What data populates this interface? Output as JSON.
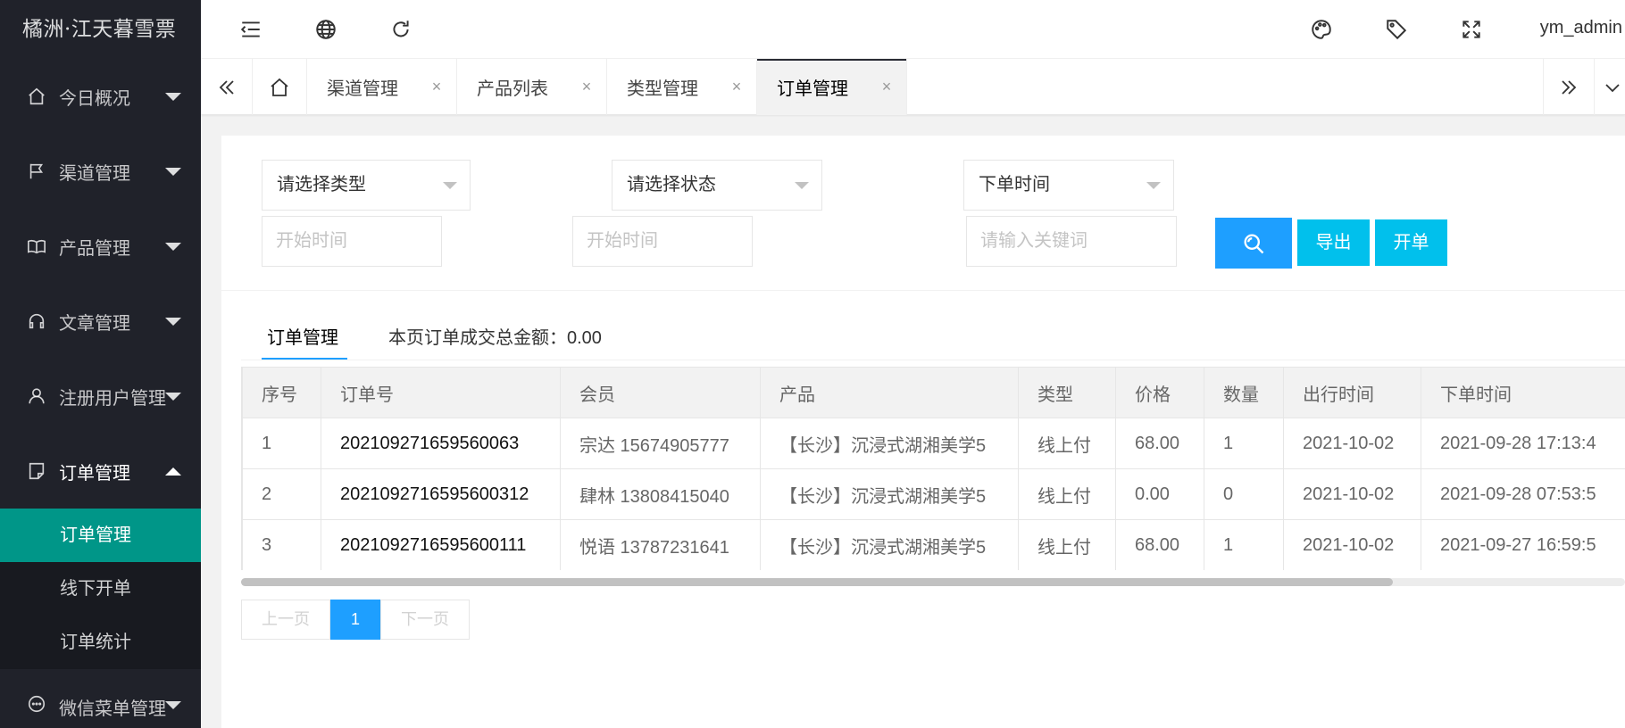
{
  "app": {
    "logo": "橘洲·江天暮雪票"
  },
  "sidebar": {
    "items": [
      {
        "label": "今日概况",
        "icon": "home-icon"
      },
      {
        "label": "渠道管理",
        "icon": "flag-icon"
      },
      {
        "label": "产品管理",
        "icon": "book-icon"
      },
      {
        "label": "文章管理",
        "icon": "headset-icon"
      },
      {
        "label": "注册用户管理",
        "icon": "user-icon"
      },
      {
        "label": "订单管理",
        "icon": "note-icon",
        "open": true
      },
      {
        "label": "微信菜单管理",
        "icon": "chat-icon"
      }
    ],
    "submenu": [
      {
        "label": "订单管理",
        "active": true
      },
      {
        "label": "线下开单"
      },
      {
        "label": "订单统计"
      }
    ]
  },
  "header": {
    "icons": [
      "menu-fold-icon",
      "globe-icon",
      "refresh-icon",
      "palette-icon",
      "tag-icon",
      "fullscreen-icon"
    ],
    "user": "ym_admin"
  },
  "tabs": {
    "items": [
      {
        "label": "渠道管理"
      },
      {
        "label": "产品列表"
      },
      {
        "label": "类型管理"
      },
      {
        "label": "订单管理",
        "active": true
      }
    ],
    "close_glyph": "×"
  },
  "filters": {
    "type_select": "请选择类型",
    "status_select": "请选择状态",
    "time_select": "下单时间",
    "start_time_1": "开始时间",
    "start_time_2": "开始时间",
    "keyword": "请输入关键词",
    "export_label": "导出",
    "open_label": "开单"
  },
  "summary": {
    "tab_label": "订单管理",
    "total_text": "本页订单成交总金额：0.00"
  },
  "table": {
    "headers": [
      "序号",
      "订单号",
      "会员",
      "产品",
      "类型",
      "价格",
      "数量",
      "出行时间",
      "下单时间"
    ],
    "rows": [
      [
        "1",
        "202109271659560063",
        "宗达 15674905777",
        "【长沙】沉浸式湖湘美学5",
        "线上付",
        "68.00",
        "1",
        "2021-10-02",
        "2021-09-28 17:13:4"
      ],
      [
        "2",
        "2021092716595600312",
        "肆林 13808415040",
        "【长沙】沉浸式湖湘美学5",
        "线上付",
        "0.00",
        "0",
        "2021-10-02",
        "2021-09-28 07:53:5"
      ],
      [
        "3",
        "2021092716595600111",
        "悦语 13787231641",
        "【长沙】沉浸式湖湘美学5",
        "线上付",
        "68.00",
        "1",
        "2021-10-02",
        "2021-09-27 16:59:5"
      ]
    ]
  },
  "pager": {
    "prev": "上一页",
    "current": "1",
    "next": "下一页"
  },
  "colors": {
    "sidebar": "#20222a",
    "active_menu": "#009688",
    "primary": "#1e9fff",
    "secondary_btn": "#01c0ec"
  }
}
